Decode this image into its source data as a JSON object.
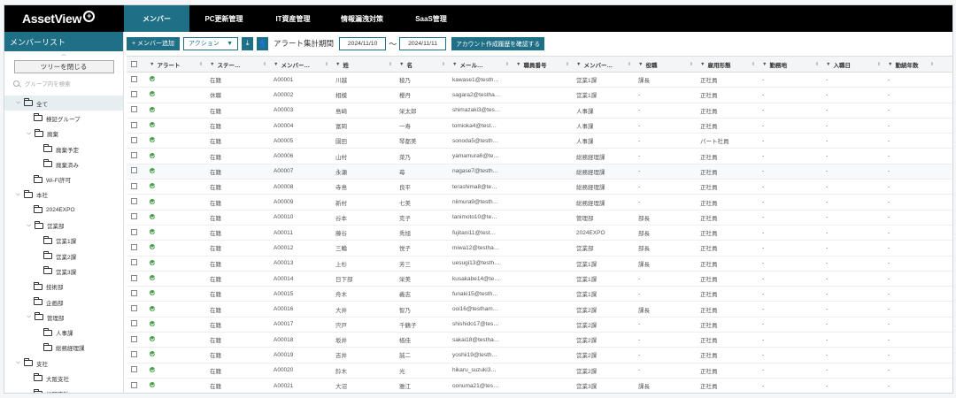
{
  "logo": "AssetView",
  "nav": [
    "メンバー",
    "PC更新管理",
    "IT資産管理",
    "情報漏洩対策",
    "SaaS管理"
  ],
  "sidebar": {
    "title": "メンバーリスト",
    "collapse_label": "ツリーを閉じる",
    "search_placeholder": "グループ内を検索",
    "tree": [
      {
        "label": "全て",
        "indent": 0,
        "caret": "open",
        "selected": true
      },
      {
        "label": "検証グループ",
        "indent": 1,
        "caret": "none"
      },
      {
        "label": "廃棄",
        "indent": 1,
        "caret": "open"
      },
      {
        "label": "廃棄予定",
        "indent": 2,
        "caret": "none"
      },
      {
        "label": "廃棄済み",
        "indent": 2,
        "caret": "none"
      },
      {
        "label": "Wi-Fi許可",
        "indent": 1,
        "caret": "none"
      },
      {
        "label": "本社",
        "indent": 0,
        "caret": "open"
      },
      {
        "label": "2024EXPO",
        "indent": 1,
        "caret": "none"
      },
      {
        "label": "営業部",
        "indent": 1,
        "caret": "open"
      },
      {
        "label": "営業1課",
        "indent": 2,
        "caret": "none"
      },
      {
        "label": "営業2課",
        "indent": 2,
        "caret": "none"
      },
      {
        "label": "営業3課",
        "indent": 2,
        "caret": "none"
      },
      {
        "label": "技術部",
        "indent": 1,
        "caret": "none"
      },
      {
        "label": "企画部",
        "indent": 1,
        "caret": "none"
      },
      {
        "label": "管理部",
        "indent": 1,
        "caret": "open"
      },
      {
        "label": "人事課",
        "indent": 2,
        "caret": "none"
      },
      {
        "label": "総務経理課",
        "indent": 2,
        "caret": "none"
      },
      {
        "label": "支社",
        "indent": 0,
        "caret": "open"
      },
      {
        "label": "大阪支社",
        "indent": 1,
        "caret": "none"
      },
      {
        "label": "福岡支社",
        "indent": 1,
        "caret": "none"
      }
    ]
  },
  "toolbar": {
    "add_label": "+ メンバー追加",
    "action_label": "アクション",
    "alert_period_label": "アラート集計期間",
    "date_from": "2024/11/10",
    "date_to": "2024/11/11",
    "tilde": "〜",
    "confirm_label": "アカウント作成履歴を確認する"
  },
  "table": {
    "headers": [
      "アラート",
      "ステー…",
      "メンバー…",
      "姓",
      "名",
      "メール…",
      "職員番号",
      "メンバー…",
      "役職",
      "雇用形態",
      "勤務地",
      "入職日",
      "勤続年数"
    ],
    "rows": [
      [
        "在籍",
        "A00001",
        "川越",
        "稜乃",
        "kawase1@testh…",
        "",
        "営業1課",
        "課長",
        "正社員",
        "-",
        "-",
        "-"
      ],
      [
        "休職",
        "A00002",
        "相模",
        "櫻丹",
        "sagara2@testha…",
        "",
        "営業1課",
        "-",
        "正社員",
        "-",
        "-",
        "-"
      ],
      [
        "在籍",
        "A00003",
        "島崎",
        "栄太郎",
        "shimazaki3@tes…",
        "",
        "人事課",
        "-",
        "正社員",
        "-",
        "-",
        "-"
      ],
      [
        "在籍",
        "A00004",
        "富岡",
        "一寿",
        "tomioka4@test…",
        "",
        "人事課",
        "-",
        "正社員",
        "-",
        "-",
        "-"
      ],
      [
        "在籍",
        "A00005",
        "園田",
        "琴都美",
        "sonoda5@testh…",
        "",
        "人事課",
        "-",
        "パート社員",
        "-",
        "-",
        "-"
      ],
      [
        "在籍",
        "A00006",
        "山村",
        "菜乃",
        "yamamura6@te…",
        "",
        "総務経理課",
        "-",
        "正社員",
        "-",
        "-",
        "-"
      ],
      [
        "在籍",
        "A00007",
        "永瀬",
        "苺",
        "nagase7@testh…",
        "",
        "総務経理課",
        "-",
        "正社員",
        "-",
        "-",
        "-"
      ],
      [
        "在籍",
        "A00008",
        "寺島",
        "良平",
        "terashima8@te…",
        "",
        "総務経理課",
        "-",
        "正社員",
        "-",
        "-",
        "-"
      ],
      [
        "在籍",
        "A00009",
        "新村",
        "七美",
        "niimura9@testh…",
        "",
        "総務経理課",
        "-",
        "正社員",
        "-",
        "-",
        "-"
      ],
      [
        "在籍",
        "A00010",
        "谷本",
        "克子",
        "tanimoto10@te…",
        "",
        "管理部",
        "部長",
        "正社員",
        "-",
        "-",
        "-"
      ],
      [
        "在籍",
        "A00011",
        "藤谷",
        "秀旭",
        "fujitani11@test…",
        "",
        "2024EXPO",
        "部長",
        "正社員",
        "-",
        "-",
        "-"
      ],
      [
        "在籍",
        "A00012",
        "三輪",
        "悦子",
        "miwa12@testha…",
        "",
        "営業部",
        "部長",
        "正社員",
        "-",
        "-",
        "-"
      ],
      [
        "在籍",
        "A00013",
        "上杉",
        "芳三",
        "uesugi13@testh…",
        "",
        "営業1課",
        "課長",
        "正社員",
        "-",
        "-",
        "-"
      ],
      [
        "在籍",
        "A00014",
        "日下部",
        "栄美",
        "kusakabe14@te…",
        "",
        "営業1課",
        "-",
        "正社員",
        "-",
        "-",
        "-"
      ],
      [
        "在籍",
        "A00015",
        "舟木",
        "義志",
        "funaki15@testh…",
        "",
        "営業1課",
        "-",
        "正社員",
        "-",
        "-",
        "-"
      ],
      [
        "在籍",
        "A00016",
        "大井",
        "智乃",
        "ooi16@testham…",
        "",
        "営業2課",
        "課長",
        "正社員",
        "-",
        "-",
        "-"
      ],
      [
        "在籍",
        "A00017",
        "宍戸",
        "千鶴子",
        "shishido17@tes…",
        "",
        "営業2課",
        "-",
        "正社員",
        "-",
        "-",
        "-"
      ],
      [
        "在籍",
        "A00018",
        "坂井",
        "楢佳",
        "sakai18@testha…",
        "",
        "営業2課",
        "-",
        "正社員",
        "-",
        "-",
        "-"
      ],
      [
        "在籍",
        "A00019",
        "吉井",
        "誠二",
        "yoshii19@testh…",
        "",
        "営業2課",
        "-",
        "正社員",
        "-",
        "-",
        "-"
      ],
      [
        "在籍",
        "A00020",
        "鈴木",
        "光",
        "hikaru_suzuki3…",
        "",
        "営業2課",
        "-",
        "正社員",
        "-",
        "-",
        "-"
      ],
      [
        "在籍",
        "A00021",
        "大沼",
        "雅江",
        "oonuma21@tes…",
        "",
        "営業3課",
        "課長",
        "正社員",
        "-",
        "-",
        "-"
      ]
    ]
  },
  "colors": {
    "accent": "#1f6f87",
    "alert_ok": "#43a047",
    "nav_bg": "#000000"
  }
}
